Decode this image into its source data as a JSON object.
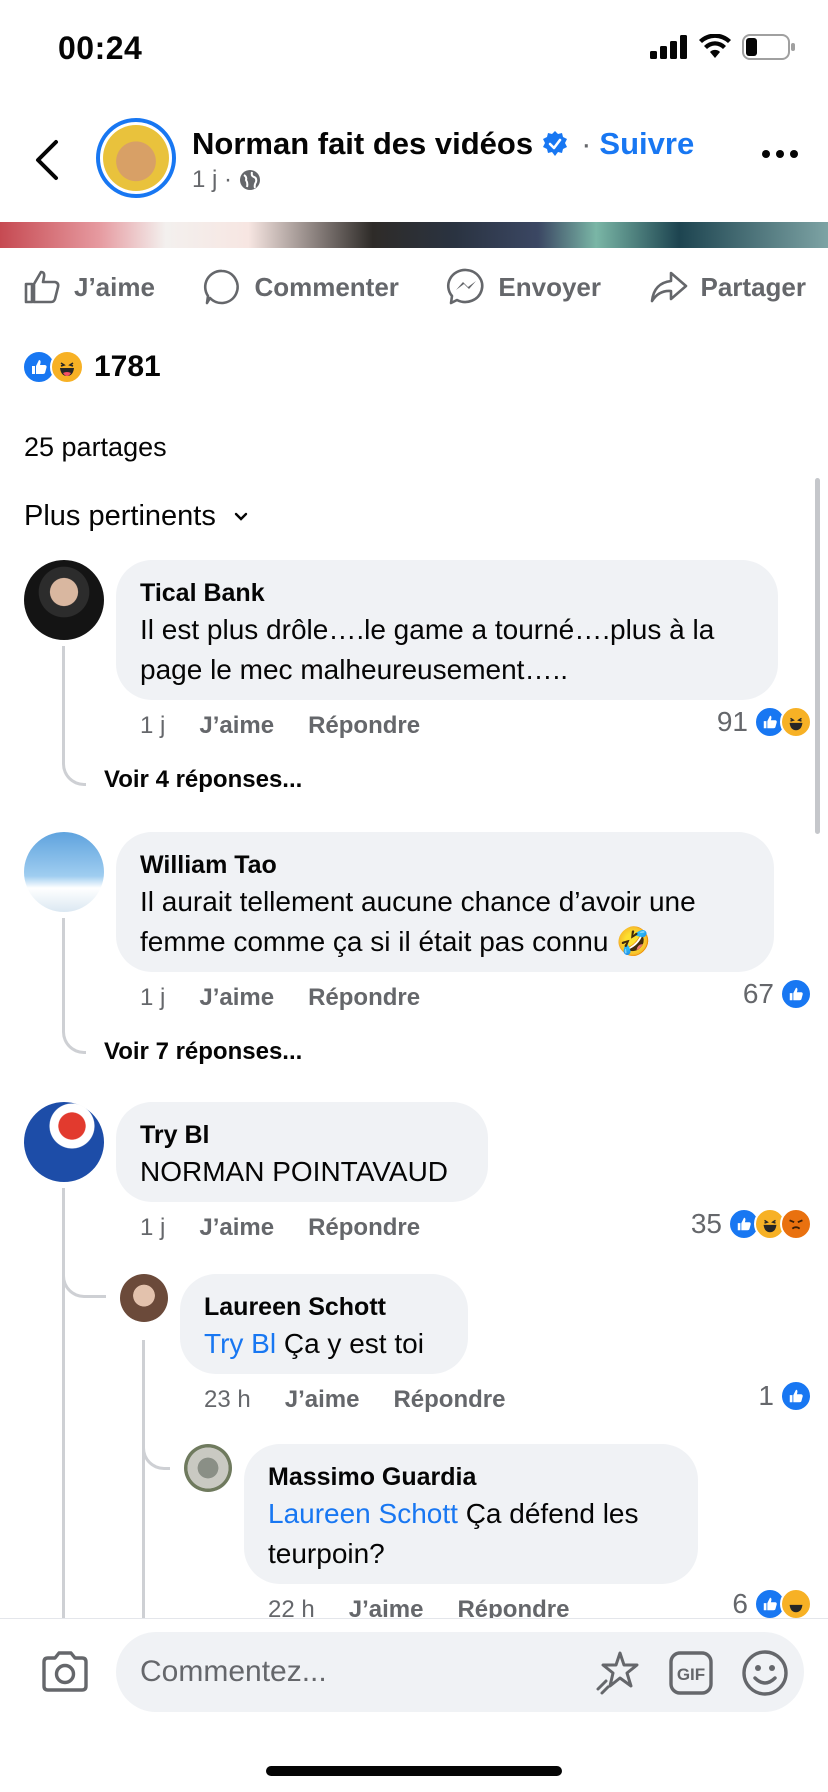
{
  "status": {
    "time": "00:24"
  },
  "header": {
    "page_name": "Norman fait des vidéos",
    "follow_sep": "·",
    "follow": "Suivre",
    "meta": "1 j ·"
  },
  "actions": [
    {
      "label": "J’aime",
      "icon": "thumbs-up-icon"
    },
    {
      "label": "Commenter",
      "icon": "comment-icon"
    },
    {
      "label": "Envoyer",
      "icon": "messenger-icon"
    },
    {
      "label": "Partager",
      "icon": "share-icon"
    }
  ],
  "post_stats": {
    "reaction_count": "1781",
    "shares": "25 partages",
    "sort": "Plus pertinents"
  },
  "comments": [
    {
      "name": "Tical Bank",
      "text_line1": "Il est plus drôle….le game a tourné….plus à la",
      "text_line2": "page le mec malheureusement…..",
      "time": "1 j",
      "like": "J’aime",
      "reply": "Répondre",
      "count": "91",
      "see_replies": "Voir 4 réponses..."
    },
    {
      "name": "William Tao",
      "text_line1": "Il aurait tellement aucune chance d’avoir une",
      "text_line2": "femme comme ça si il était pas connu 🤣",
      "time": "1 j",
      "like": "J’aime",
      "reply": "Répondre",
      "count": "67",
      "see_replies": "Voir 7 réponses..."
    },
    {
      "name": "Try Bl",
      "text": "NORMAN POINTAVAUD",
      "time": "1 j",
      "like": "J’aime",
      "reply": "Répondre",
      "count": "35"
    }
  ],
  "replies": [
    {
      "name": "Laureen Schott",
      "mention": "Try Bl",
      "text": " Ça y est toi",
      "time": "23 h",
      "like": "J’aime",
      "reply": "Répondre",
      "count": "1"
    },
    {
      "name": "Massimo Guardia",
      "mention": "Laureen Schott",
      "text": " Ça défend les",
      "text_line2": "teurpoin?",
      "time": "22 h",
      "like": "J’aime",
      "reply": "Répondre",
      "count": "6"
    }
  ],
  "composer": {
    "placeholder": "Commentez..."
  },
  "colors": {
    "accent": "#1877f2",
    "secondary_text": "#65676b",
    "bubble": "#f0f2f5"
  }
}
